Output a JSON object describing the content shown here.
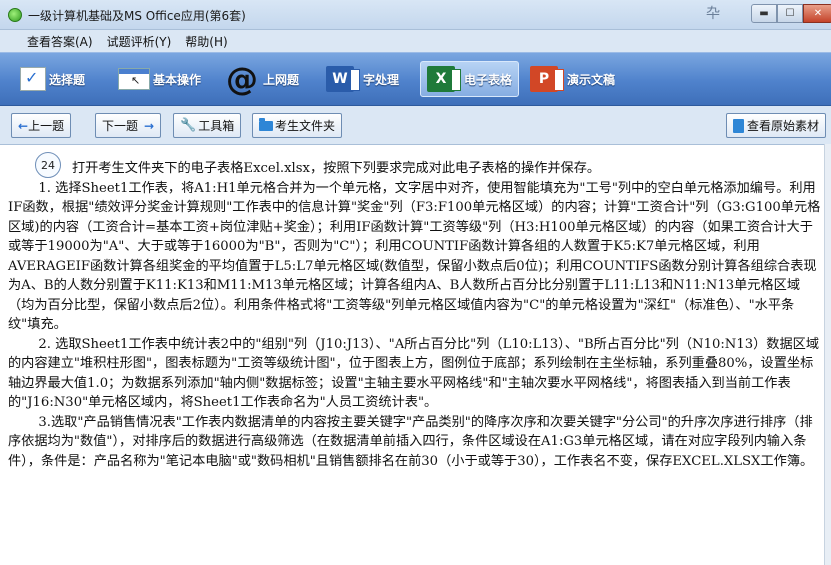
{
  "window": {
    "title": "一级计算机基础及MS Office应用(第6套)",
    "pin_glyph": "卆",
    "minimize_glyph": "▬",
    "maximize_glyph": "☐",
    "close_glyph": "✕"
  },
  "menu": [
    "查看答案(A)",
    "试题评析(Y)",
    "帮助(H)"
  ],
  "modules": [
    {
      "label": "选择题",
      "icon": "checkmark-icon"
    },
    {
      "label": "基本操作",
      "icon": "window-icon"
    },
    {
      "label": "上网题",
      "icon": "at-icon",
      "glyph": "@"
    },
    {
      "label": "字处理",
      "icon": "word-icon",
      "glyph": "W"
    },
    {
      "label": "电子表格",
      "icon": "excel-icon",
      "glyph": "X",
      "active": true
    },
    {
      "label": "演示文稿",
      "icon": "powerpoint-icon",
      "glyph": "P"
    }
  ],
  "toolbar": {
    "prev_arrow": "←",
    "prev_label": "上一题",
    "next_label": "下一题",
    "next_arrow": "→",
    "tools_label": "工具箱",
    "folder_label": "考生文件夹",
    "source_label": "查看原始素材"
  },
  "question": {
    "number": "24",
    "paragraphs": [
      "打开考生文件夹下的电子表格Excel.xlsx，按照下列要求完成对此电子表格的操作并保存。",
      "1. 选择Sheet1工作表，将A1:H1单元格合并为一个单元格，文字居中对齐，使用智能填充为\"工号\"列中的空白单元格添加编号。利用IF函数，根据\"绩效评分奖金计算规则\"工作表中的信息计算\"奖金\"列（F3:F100单元格区域）的内容；计算\"工资合计\"列（G3:G100单元格区域)的内容（工资合计=基本工资+岗位津贴+奖金）；利用IF函数计算\"工资等级\"列（H3:H100单元格区域）的内容（如果工资合计大于或等于19000为\"A\"、大于或等于16000为\"B\"，否则为\"C\"）；利用COUNTIF函数计算各组的人数置于K5:K7单元格区域，利用AVERAGEIF函数计算各组奖金的平均值置于L5:L7单元格区域(数值型，保留小数点后0位)；利用COUNTIFS函数分别计算各组综合表现为A、B的人数分别置于K11:K13和M11:M13单元格区域；计算各组内A、B人数所占百分比分别置于L11:L13和N11:N13单元格区域（均为百分比型，保留小数点后2位）。利用条件格式将\"工资等级\"列单元格区域值内容为\"C\"的单元格设置为\"深红\"（标准色）、\"水平条纹\"填充。",
      "2. 选取Sheet1工作表中统计表2中的\"组别\"列（J10:J13）、\"A所占百分比\"列（L10:L13）、\"B所占百分比\"列（N10:N13）数据区域的内容建立\"堆积柱形图\"，图表标题为\"工资等级统计图\"，位于图表上方，图例位于底部；系列绘制在主坐标轴，系列重叠80%，设置坐标轴边界最大值1.0；为数据系列添加\"轴内侧\"数据标签；设置\"主轴主要水平网格线\"和\"主轴次要水平网格线\"，将图表插入到当前工作表的\"J16:N30\"单元格区域内，将Sheet1工作表命名为\"人员工资统计表\"。",
      "3.选取\"产品销售情况表\"工作表内数据清单的内容按主要关键字\"产品类别\"的降序次序和次要关键字\"分公司\"的升序次序进行排序（排序依据均为\"数值\"），对排序后的数据进行高级筛选（在数据清单前插入四行，条件区域设在A1:G3单元格区域，请在对应字段列内输入条件），条件是：产品名称为\"笔记本电脑\"或\"数码相机\"且销售额排名在前30（小于或等于30），工作表名不变，保存EXCEL.XLSX工作簿。"
    ]
  }
}
